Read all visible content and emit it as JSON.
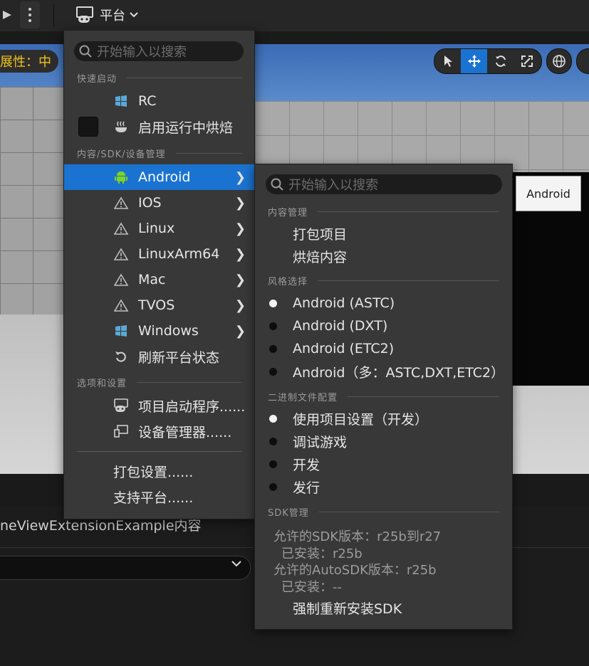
{
  "toolbar": {
    "platform_label": "平台"
  },
  "viewport": {
    "property_badge": "展性：中",
    "tools": [
      "select-arrow-icon",
      "move-cross-icon",
      "rotate-icon",
      "scale-icon"
    ]
  },
  "main_menu": {
    "search_placeholder": "开始输入以搜索",
    "section_quick_launch": "快速启动",
    "quick_launch": [
      {
        "label": "RC",
        "icon": "windows-icon"
      },
      {
        "label": "启用运行中烘焙",
        "icon": "cook-icon"
      }
    ],
    "section_sdk": "内容/SDK/设备管理",
    "platforms": [
      {
        "label": "Android",
        "icon": "android-icon"
      },
      {
        "label": "IOS",
        "icon": "warning-icon"
      },
      {
        "label": "Linux",
        "icon": "warning-icon"
      },
      {
        "label": "LinuxArm64",
        "icon": "warning-icon"
      },
      {
        "label": "Mac",
        "icon": "warning-icon"
      },
      {
        "label": "TVOS",
        "icon": "warning-icon"
      },
      {
        "label": "Windows",
        "icon": "windows-icon"
      }
    ],
    "refresh_label": "刷新平台状态",
    "section_options": "选项和设置",
    "options": [
      {
        "label": "项目启动程序......",
        "icon": "gamepad-icon"
      },
      {
        "label": "设备管理器......",
        "icon": "device-icon"
      }
    ],
    "package_settings": "打包设置......",
    "supported_platforms": "支持平台......"
  },
  "sub_menu": {
    "search_placeholder": "开始输入以搜索",
    "section_content": "内容管理",
    "content_items": [
      "打包项目",
      "烘焙内容"
    ],
    "section_flavor": "风格选择",
    "flavors": [
      {
        "label": "Android (ASTC)",
        "selected": true
      },
      {
        "label": "Android (DXT)",
        "selected": false
      },
      {
        "label": "Android (ETC2)",
        "selected": false
      },
      {
        "label": "Android（多：ASTC,DXT,ETC2）",
        "selected": false
      }
    ],
    "section_binary": "二进制文件配置",
    "binary_configs": [
      {
        "label": "使用项目设置（开发）",
        "selected": true
      },
      {
        "label": "调试游戏",
        "selected": false
      },
      {
        "label": "开发",
        "selected": false
      },
      {
        "label": "发行",
        "selected": false
      }
    ],
    "section_sdk": "SDK管理",
    "sdk_allowed": "允许的SDK版本：r25b到r27",
    "sdk_installed": "已安装：r25b",
    "autosdk_allowed": "允许的AutoSDK版本：r25b",
    "autosdk_installed": "已安装：--",
    "force_reinstall": "强制重新安装SDK"
  },
  "tooltip": "Android",
  "content_browser": {
    "path_label": "neViewExtensionExample内容"
  }
}
